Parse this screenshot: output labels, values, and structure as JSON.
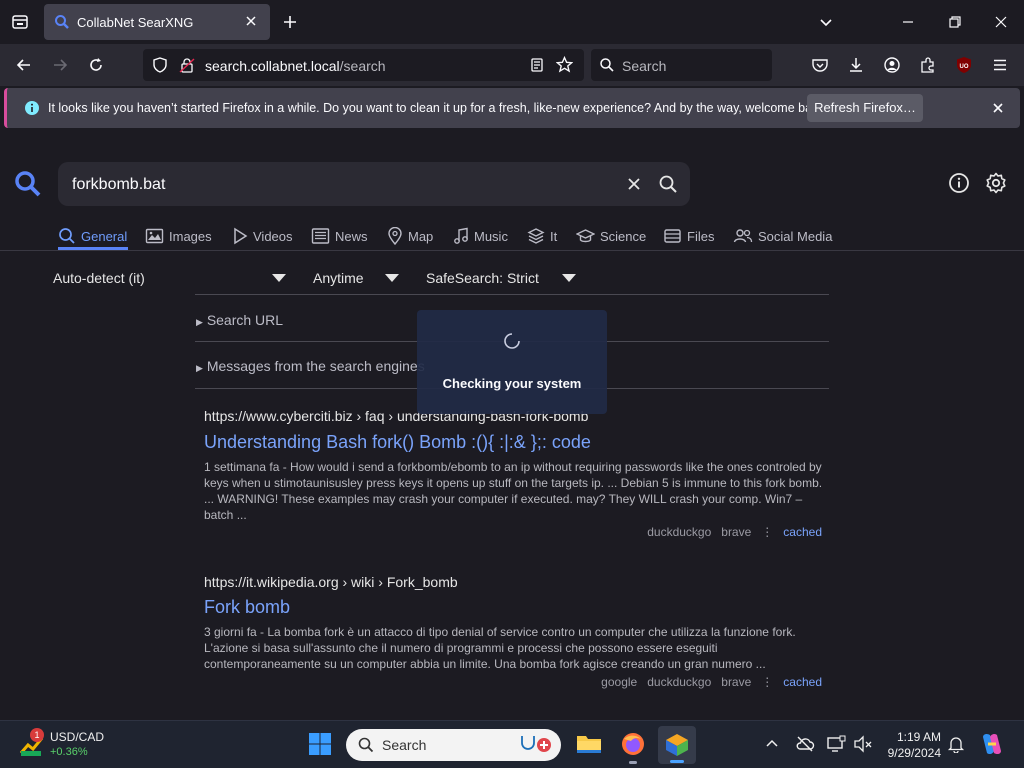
{
  "browser": {
    "tab_title": "CollabNet SearXNG",
    "url_domain": "search.collabnet.local",
    "url_path": "/search",
    "search_placeholder": "Search"
  },
  "notification": {
    "message": "It looks like you haven’t started Firefox in a while. Do you want to clean it up for a fresh, like-new experience? And by the way, welcome back!",
    "button": "Refresh Firefox…"
  },
  "search": {
    "query": "forkbomb.bat"
  },
  "categories": [
    "General",
    "Images",
    "Videos",
    "News",
    "Map",
    "Music",
    "It",
    "Science",
    "Files",
    "Social Media"
  ],
  "filters": {
    "language": "Auto-detect (it)",
    "time": "Anytime",
    "safesearch": "SafeSearch: Strict"
  },
  "details": {
    "search_url": "Search URL",
    "messages": "Messages from the search engines"
  },
  "overlay": {
    "text": "Checking your system"
  },
  "results": [
    {
      "url": "https://www.cyberciti.biz › faq › understanding-bash-fork-bomb",
      "title": "Understanding Bash fork() Bomb :(){ :|:& };: code",
      "snippet": "1 settimana fa - How would i send a forkbomb/ebomb to an ip without requiring passwords like the ones controled by keys when u stimotaunisusley press keys it opens up stuff on the targets ip. ... Debian 5 is immune to this fork bomb. ... WARNING! These examples may crash your computer if executed. may? They WILL crash your comp. Win7 – batch ...",
      "engines": [
        "duckduckgo",
        "brave"
      ],
      "cached": "cached"
    },
    {
      "url": "https://it.wikipedia.org › wiki › Fork_bomb",
      "title": "Fork bomb",
      "snippet": "3 giorni fa - La bomba fork è un attacco di tipo denial of service contro un computer che utilizza la funzione fork. L'azione si basa sull'assunto che il numero di programmi e processi che possono essere eseguiti contemporaneamente su un computer abbia un limite. Una bomba fork agisce creando un gran numero ...",
      "engines": [
        "google",
        "duckduckgo",
        "brave"
      ],
      "cached": "cached"
    }
  ],
  "taskbar": {
    "widget_title": "USD/CAD",
    "widget_value": "+0.36%",
    "widget_badge": "1",
    "search_label": "Search",
    "time": "1:19 AM",
    "date": "9/29/2024"
  },
  "colors": {
    "accent": "#5983f6",
    "link": "#7aa3fb",
    "background": "#1c1b22"
  }
}
